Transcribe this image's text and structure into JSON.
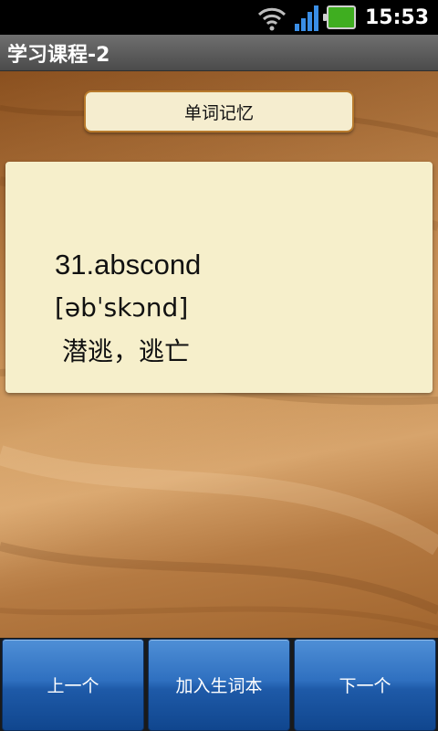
{
  "status_bar": {
    "time": "15:53",
    "icons": [
      "wifi-icon",
      "signal-icon",
      "battery-icon"
    ],
    "battery_color": "#3fae20"
  },
  "app": {
    "title": "学习课程-2"
  },
  "section": {
    "label": "单词记忆"
  },
  "card": {
    "word": "31.abscond",
    "phonetic": "[əbˈskɔnd]",
    "meaning": "潜逃，逃亡"
  },
  "buttons": {
    "prev_label": "上一个",
    "add_label": "加入生词本",
    "next_label": "下一个",
    "color": "#1e5aa8"
  }
}
